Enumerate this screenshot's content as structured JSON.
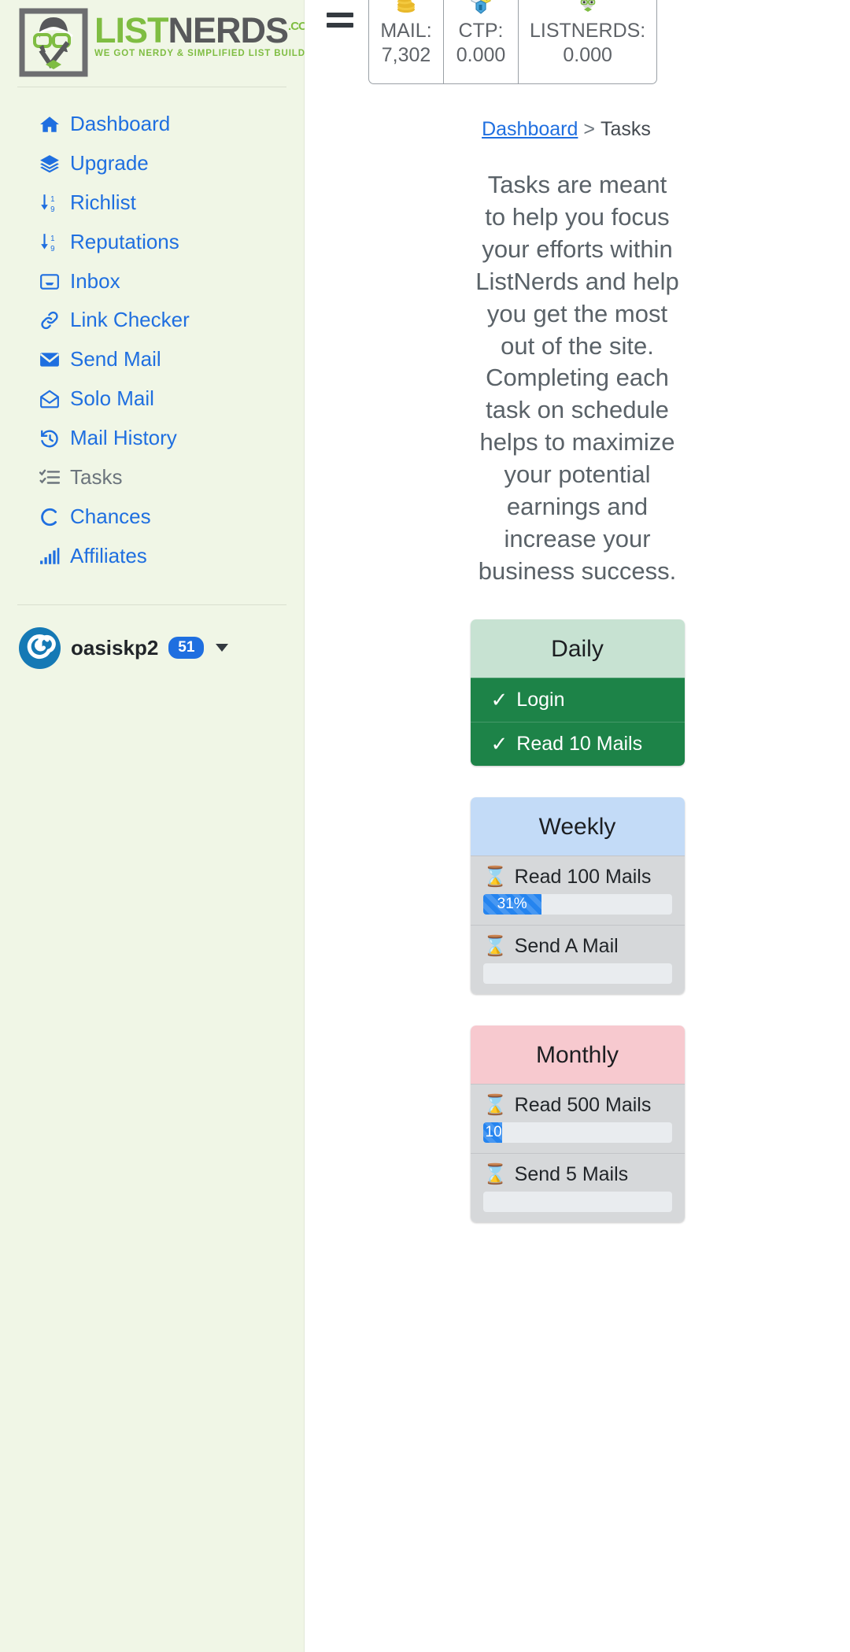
{
  "brand": {
    "name_part1": "LIST",
    "name_part2": "NERDS",
    "domain_suffix": ".COM",
    "tagline": "WE GOT NERDY & SIMPLIFIED LIST BUILDERS!",
    "logo_icon": "nerd-face-logo-icon",
    "green": "#7fbd42",
    "gray": "#58595b"
  },
  "sidebar": {
    "items": [
      {
        "label": "Dashboard",
        "icon": "home-icon",
        "active": false
      },
      {
        "label": "Upgrade",
        "icon": "layers-icon",
        "active": false
      },
      {
        "label": "Richlist",
        "icon": "sort-numeric-icon",
        "active": false
      },
      {
        "label": "Reputations",
        "icon": "sort-numeric-icon",
        "active": false
      },
      {
        "label": "Inbox",
        "icon": "inbox-icon",
        "active": false
      },
      {
        "label": "Link Checker",
        "icon": "link-icon",
        "active": false
      },
      {
        "label": "Send Mail",
        "icon": "envelope-solid-icon",
        "active": false
      },
      {
        "label": "Solo Mail",
        "icon": "envelope-open-icon",
        "active": false
      },
      {
        "label": "Mail History",
        "icon": "history-icon",
        "active": false
      },
      {
        "label": "Tasks",
        "icon": "tasks-checklist-icon",
        "active": true
      },
      {
        "label": "Chances",
        "icon": "circle-c-icon",
        "active": false
      },
      {
        "label": "Affiliates",
        "icon": "signal-bars-icon",
        "active": false
      }
    ],
    "user": {
      "name": "oasiskp2",
      "badge": "51",
      "avatar_icon": "power-spiral-avatar-icon",
      "caret_icon": "chevron-down-icon"
    }
  },
  "topbar": {
    "menu_icon": "hamburger-menu-icon",
    "stats": [
      {
        "icon": "coins-icon",
        "label": "MAIL:",
        "value": "7,302"
      },
      {
        "icon": "ctp-token-icon",
        "label": "CTP:",
        "value": "0.000"
      },
      {
        "icon": "nerd-face-icon",
        "label": "LISTNERDS:",
        "value": "0.000"
      }
    ]
  },
  "breadcrumb": {
    "parent": "Dashboard",
    "separator": ">",
    "current": "Tasks"
  },
  "intro_text": "Tasks are meant to help you focus your efforts within ListNerds and help you get the most out of the site. Completing each task on schedule helps to maximize your potential earnings and increase your business success.",
  "cards": [
    {
      "title": "Daily",
      "tasks": [
        {
          "label": "Login",
          "state": "done",
          "icon": "check-icon"
        },
        {
          "label": "Read 10 Mails",
          "state": "done",
          "icon": "check-icon"
        }
      ]
    },
    {
      "title": "Weekly",
      "tasks": [
        {
          "label": "Read 100 Mails",
          "state": "pending",
          "icon": "hourglass-icon",
          "progress": 31,
          "progress_text": "31%"
        },
        {
          "label": "Send A Mail",
          "state": "pending",
          "icon": "hourglass-icon",
          "progress": 0,
          "progress_text": ""
        }
      ]
    },
    {
      "title": "Monthly",
      "tasks": [
        {
          "label": "Read 500 Mails",
          "state": "pending",
          "icon": "hourglass-icon",
          "progress": 10,
          "progress_text": "10."
        },
        {
          "label": "Send 5 Mails",
          "state": "pending",
          "icon": "hourglass-icon",
          "progress": 0,
          "progress_text": ""
        }
      ]
    }
  ],
  "colors": {
    "sidebar_bg": "#f0f6e6",
    "link_blue": "#1f6fe0",
    "done_green": "#1d8348",
    "daily_head": "#c7e2d2",
    "weekly_head": "#c3dbf7",
    "monthly_head": "#f7c9cf",
    "pending_row": "#d6d8da",
    "progress_blue": "#2584ef"
  }
}
